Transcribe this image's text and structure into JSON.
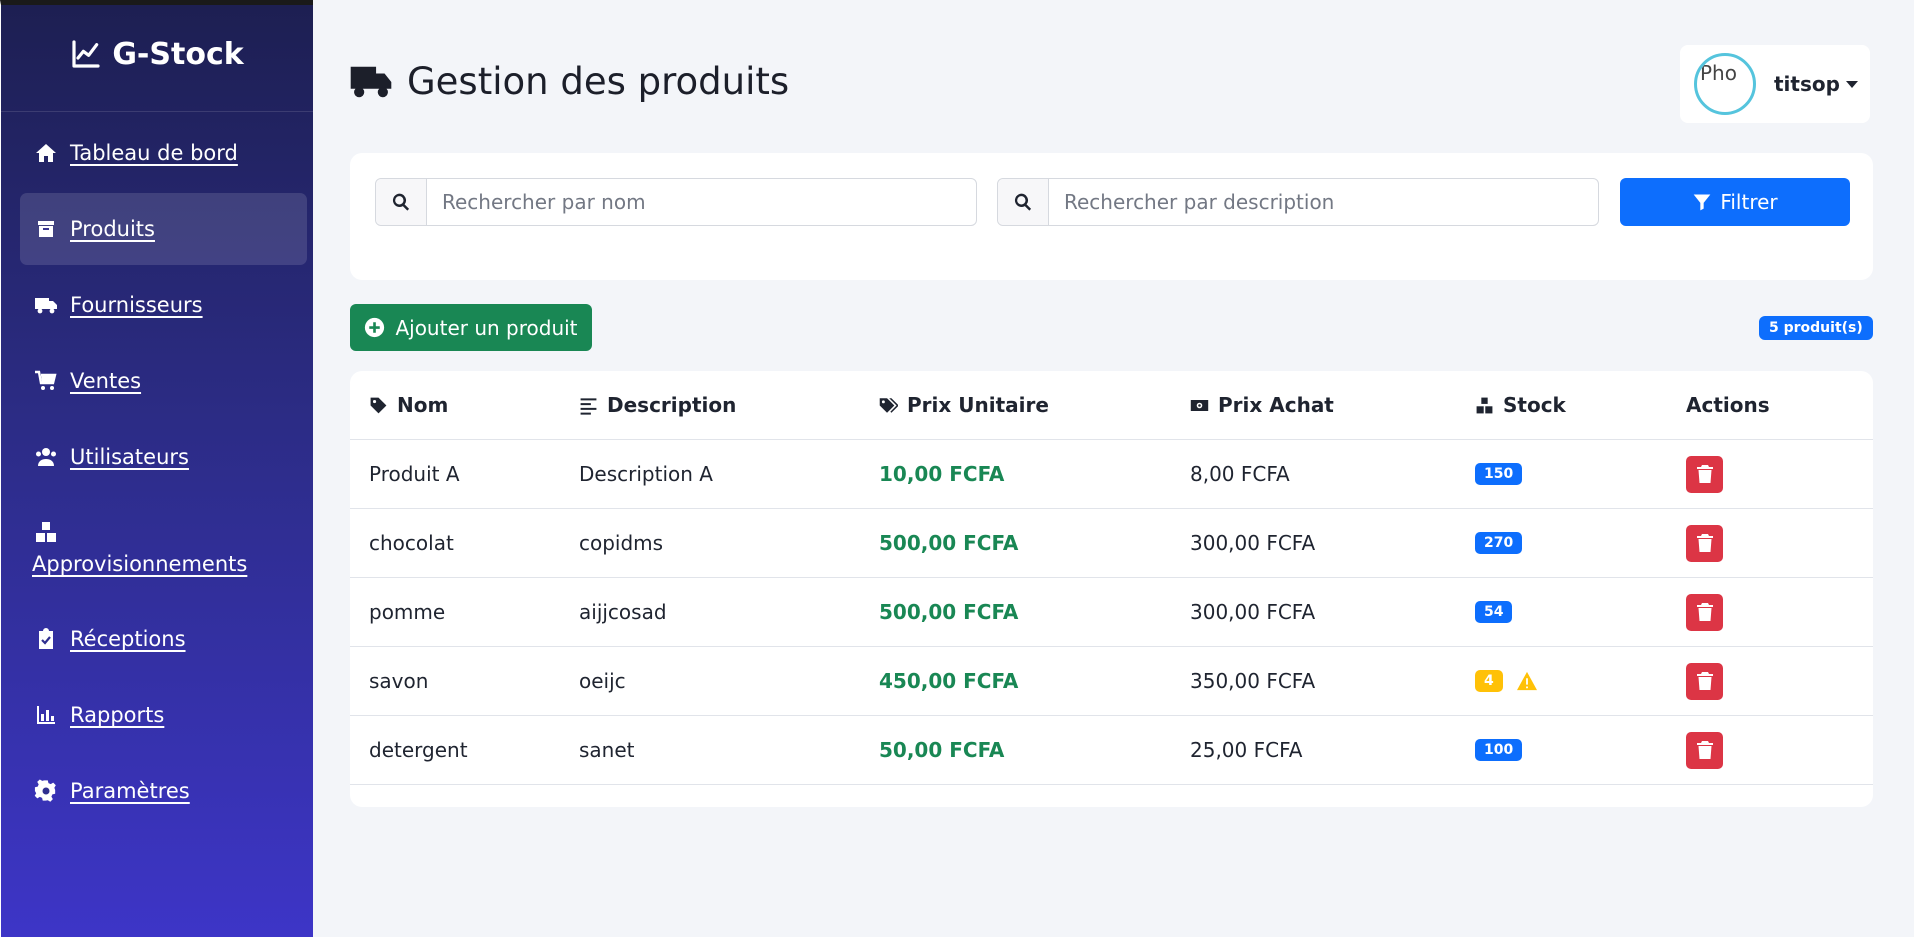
{
  "brand": {
    "name": "G-Stock"
  },
  "sidebar": {
    "items": [
      {
        "label": "Tableau de bord",
        "icon": "home-icon"
      },
      {
        "label": "Produits",
        "icon": "box-icon"
      },
      {
        "label": "Fournisseurs",
        "icon": "truck-icon"
      },
      {
        "label": "Ventes",
        "icon": "cart-icon"
      },
      {
        "label": "Utilisateurs",
        "icon": "users-icon"
      },
      {
        "label": "Approvisionnements",
        "icon": "boxes-icon"
      },
      {
        "label": "Réceptions",
        "icon": "clipboard-check-icon"
      },
      {
        "label": "Rapports",
        "icon": "chart-icon"
      },
      {
        "label": "Paramètres",
        "icon": "gear-icon"
      }
    ],
    "active_index": 1
  },
  "header": {
    "title": "Gestion des produits",
    "user": {
      "name": "titsop",
      "avatar_alt": "Pho"
    }
  },
  "filters": {
    "name_placeholder": "Rechercher par nom",
    "description_placeholder": "Rechercher par description",
    "filter_label": "Filtrer"
  },
  "actions": {
    "add_label": "Ajouter un produit",
    "count_label": "5 produit(s)"
  },
  "table": {
    "columns": [
      "Nom",
      "Description",
      "Prix Unitaire",
      "Prix Achat",
      "Stock",
      "Actions"
    ],
    "rows": [
      {
        "nom": "Produit A",
        "description": "Description A",
        "prix_unitaire": "10,00 FCFA",
        "prix_achat": "8,00 FCFA",
        "stock": "150",
        "low_stock": false
      },
      {
        "nom": "chocolat",
        "description": "copidms",
        "prix_unitaire": "500,00 FCFA",
        "prix_achat": "300,00 FCFA",
        "stock": "270",
        "low_stock": false
      },
      {
        "nom": "pomme",
        "description": "aijjcosad",
        "prix_unitaire": "500,00 FCFA",
        "prix_achat": "300,00 FCFA",
        "stock": "54",
        "low_stock": false
      },
      {
        "nom": "savon",
        "description": "oeijc",
        "prix_unitaire": "450,00 FCFA",
        "prix_achat": "350,00 FCFA",
        "stock": "4",
        "low_stock": true
      },
      {
        "nom": "detergent",
        "description": "sanet",
        "prix_unitaire": "50,00 FCFA",
        "prix_achat": "25,00 FCFA",
        "stock": "100",
        "low_stock": false
      }
    ]
  },
  "colors": {
    "primary": "#0d6efd",
    "success": "#198754",
    "danger": "#dc3545",
    "warning": "#ffc107",
    "sidebar_top": "#1d1f52",
    "sidebar_bottom": "#3d35c7"
  }
}
